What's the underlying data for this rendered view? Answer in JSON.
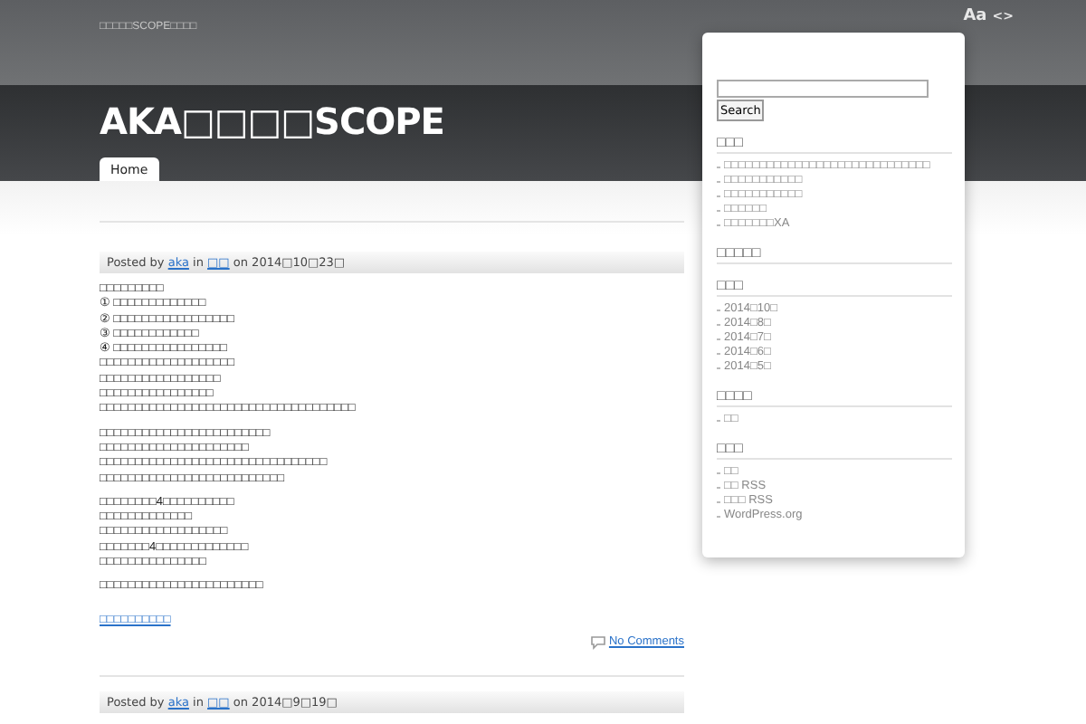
{
  "site": {
    "tagline": "□□□□□SCOPE□□□□",
    "title": "AKA□□□□SCOPE"
  },
  "header_tools": [
    {
      "label": "Aa",
      "kind": "font"
    },
    {
      "label": "<>",
      "kind": "code"
    }
  ],
  "nav": [
    {
      "label": "Home",
      "selected": true
    }
  ],
  "search": {
    "button": "Search"
  },
  "posts": [
    {
      "byline": {
        "posted_by": "Posted by",
        "author": "aka",
        "in": "in",
        "category": "□□",
        "on": "on",
        "date": "2014□10□23□"
      },
      "paragraphs": [
        [
          "□□□□□□□□□",
          "① □□□□□□□□□□□□□",
          "② □□□□□□□□□□□□□□□□□",
          "③ □□□□□□□□□□□□",
          "④ □□□□□□□□□□□□□□□□",
          "□□□□□□□□□□□□□□□□□□□",
          "□□□□□□□□□□□□□□□□□",
          "□□□□□□□□□□□□□□□□",
          "□□□□□□□□□□□□□□□□□□□□□□□□□□□□□□□□□□□□"
        ],
        [
          "□□□□□□□□□□□□□□□□□□□□□□□□",
          "□□□□□□□□□□□□□□□□□□□□□",
          "□□□□□□□□□□□□□□□□□□□□□□□□□□□□□□□□",
          "□□□□□□□□□□□□□□□□□□□□□□□□□□"
        ],
        [
          "□□□□□□□□4□□□□□□□□□□",
          "□□□□□□□□□□□□□",
          "□□□□□□□□□□□□□□□□□□",
          "□□□□□□□4□□□□□□□□□□□□□",
          "□□□□□□□□□□□□□□□"
        ],
        [
          "□□□□□□□□□□□□□□□□□□□□□□□"
        ]
      ],
      "link": "□□□□□□□□□□",
      "comments": "No Comments"
    },
    {
      "byline": {
        "posted_by": "Posted by",
        "author": "aka",
        "in": "in",
        "category": "□□",
        "on": "on",
        "date": "2014□9□19□"
      }
    }
  ],
  "widgets": [
    {
      "title": "□□□",
      "items": [
        "□□□□□□□□□□□□□□□□□□□□□□□□□□□□□",
        "□□□□□□□□□□□",
        "□□□□□□□□□□□",
        "□□□□□□",
        "□□□□□□□XA"
      ]
    },
    {
      "title": "□□□□□"
    },
    {
      "title": "□□□",
      "items": [
        "2014□10□",
        "2014□8□",
        "2014□7□",
        "2014□6□",
        "2014□5□"
      ]
    },
    {
      "title": "□□□□",
      "items": [
        "□□"
      ]
    },
    {
      "title": "□□□",
      "items": [
        "□□",
        "□□ RSS",
        "□□□ RSS",
        "WordPress.org"
      ]
    }
  ]
}
